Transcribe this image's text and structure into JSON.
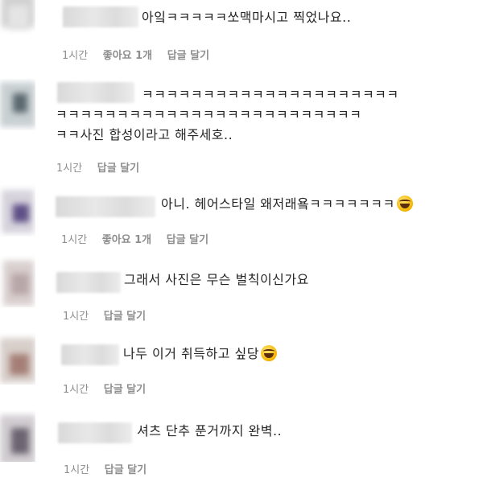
{
  "comments": [
    {
      "text_lines": [
        "아잌ㅋㅋㅋㅋㅋ쏘맥마시고 찍었나요.."
      ],
      "time": "1시간",
      "likes": "좋아요 1개",
      "reply": "답글 달기"
    },
    {
      "text_lines": [
        "ㅋㅋㅋㅋㅋㅋㅋㅋㅋㅋㅋㅋㅋㅋㅋㅋㅋㅋㅋㅋㅋ",
        "ㅋㅋㅋㅋㅋㅋㅋㅋㅋㅋㅋㅋㅋㅋㅋㅋㅋㅋㅋㅋㅋㅋㅋㅋㅋ",
        "ㅋㅋ사진 합성이라고 해주세호.."
      ],
      "time": "1시간",
      "reply": "답글 달기"
    },
    {
      "text_lines": [
        "아니. 헤어스타일 왜저래욬ㅋㅋㅋㅋㅋㅋㅋ"
      ],
      "emoji": "laughing-emoji",
      "time": "1시간",
      "likes": "좋아요 1개",
      "reply": "답글 달기"
    },
    {
      "text_lines": [
        "그래서 사진은 무슨 벌칙이신가요"
      ],
      "time": "1시간",
      "reply": "답글 달기"
    },
    {
      "text_lines": [
        "나두 이거 취득하고 싶당"
      ],
      "emoji": "laughing-emoji",
      "time": "1시간",
      "reply": "답글 달기"
    },
    {
      "text_lines": [
        "셔츠 단추 푼거까지 완벽.."
      ],
      "time": "1시간",
      "reply": "답글 달기"
    }
  ]
}
